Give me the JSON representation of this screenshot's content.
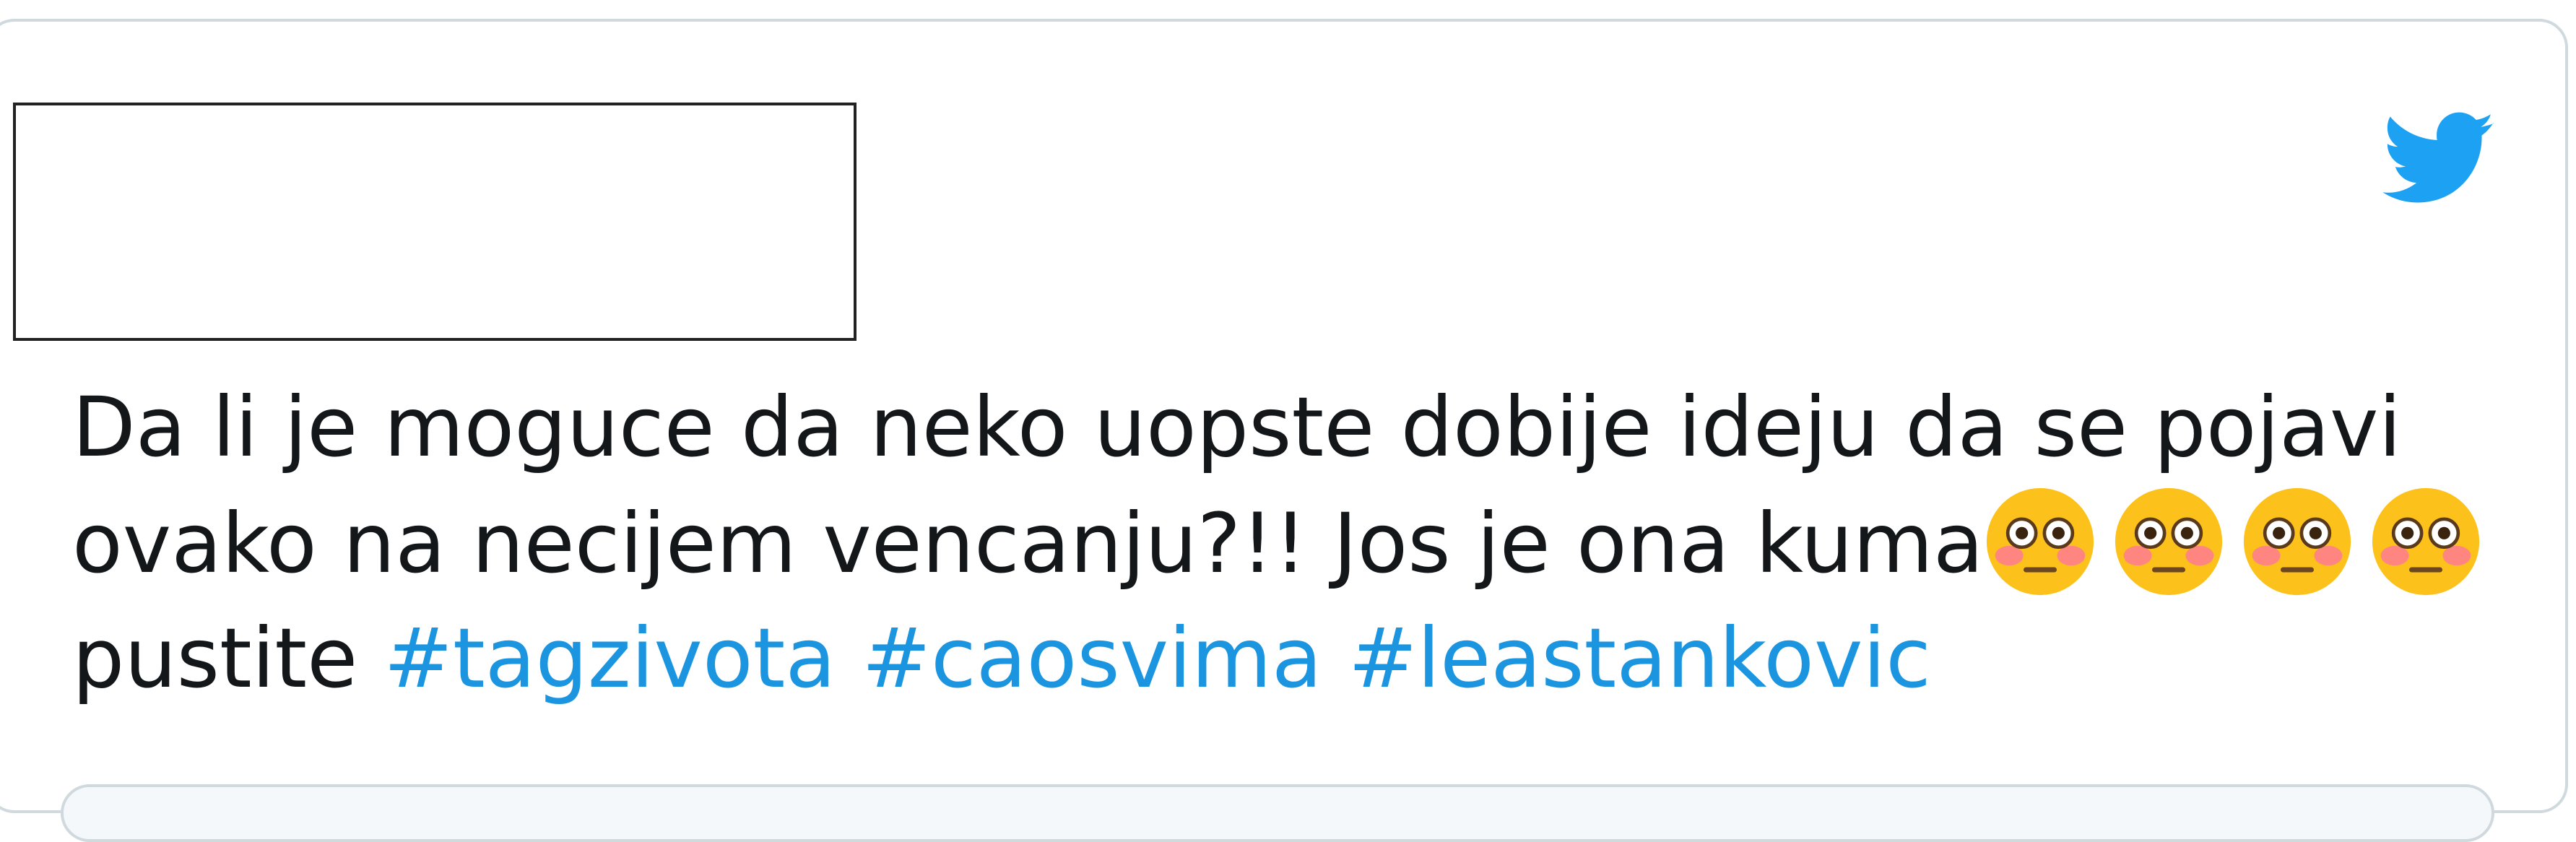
{
  "tweet": {
    "line1": "Da li je moguce da neko uopste dobije ideju da se pojavi",
    "line2_text": "ovako na necijem vencanju?!! Jos je ona kuma",
    "line3_text": "pustite",
    "hashtags": [
      "#tagzivota",
      "#caosvima",
      "#leastankovic"
    ],
    "emojis": [
      "flushed-face-emoji",
      "flushed-face-emoji",
      "flushed-face-emoji",
      "flushed-face-emoji"
    ]
  },
  "colors": {
    "text": "#14171a",
    "hashtag": "#1b95e0",
    "twitter_blue": "#1da1f2",
    "border": "#cfd9de"
  },
  "icons": {
    "brand": "twitter-bird-icon"
  }
}
